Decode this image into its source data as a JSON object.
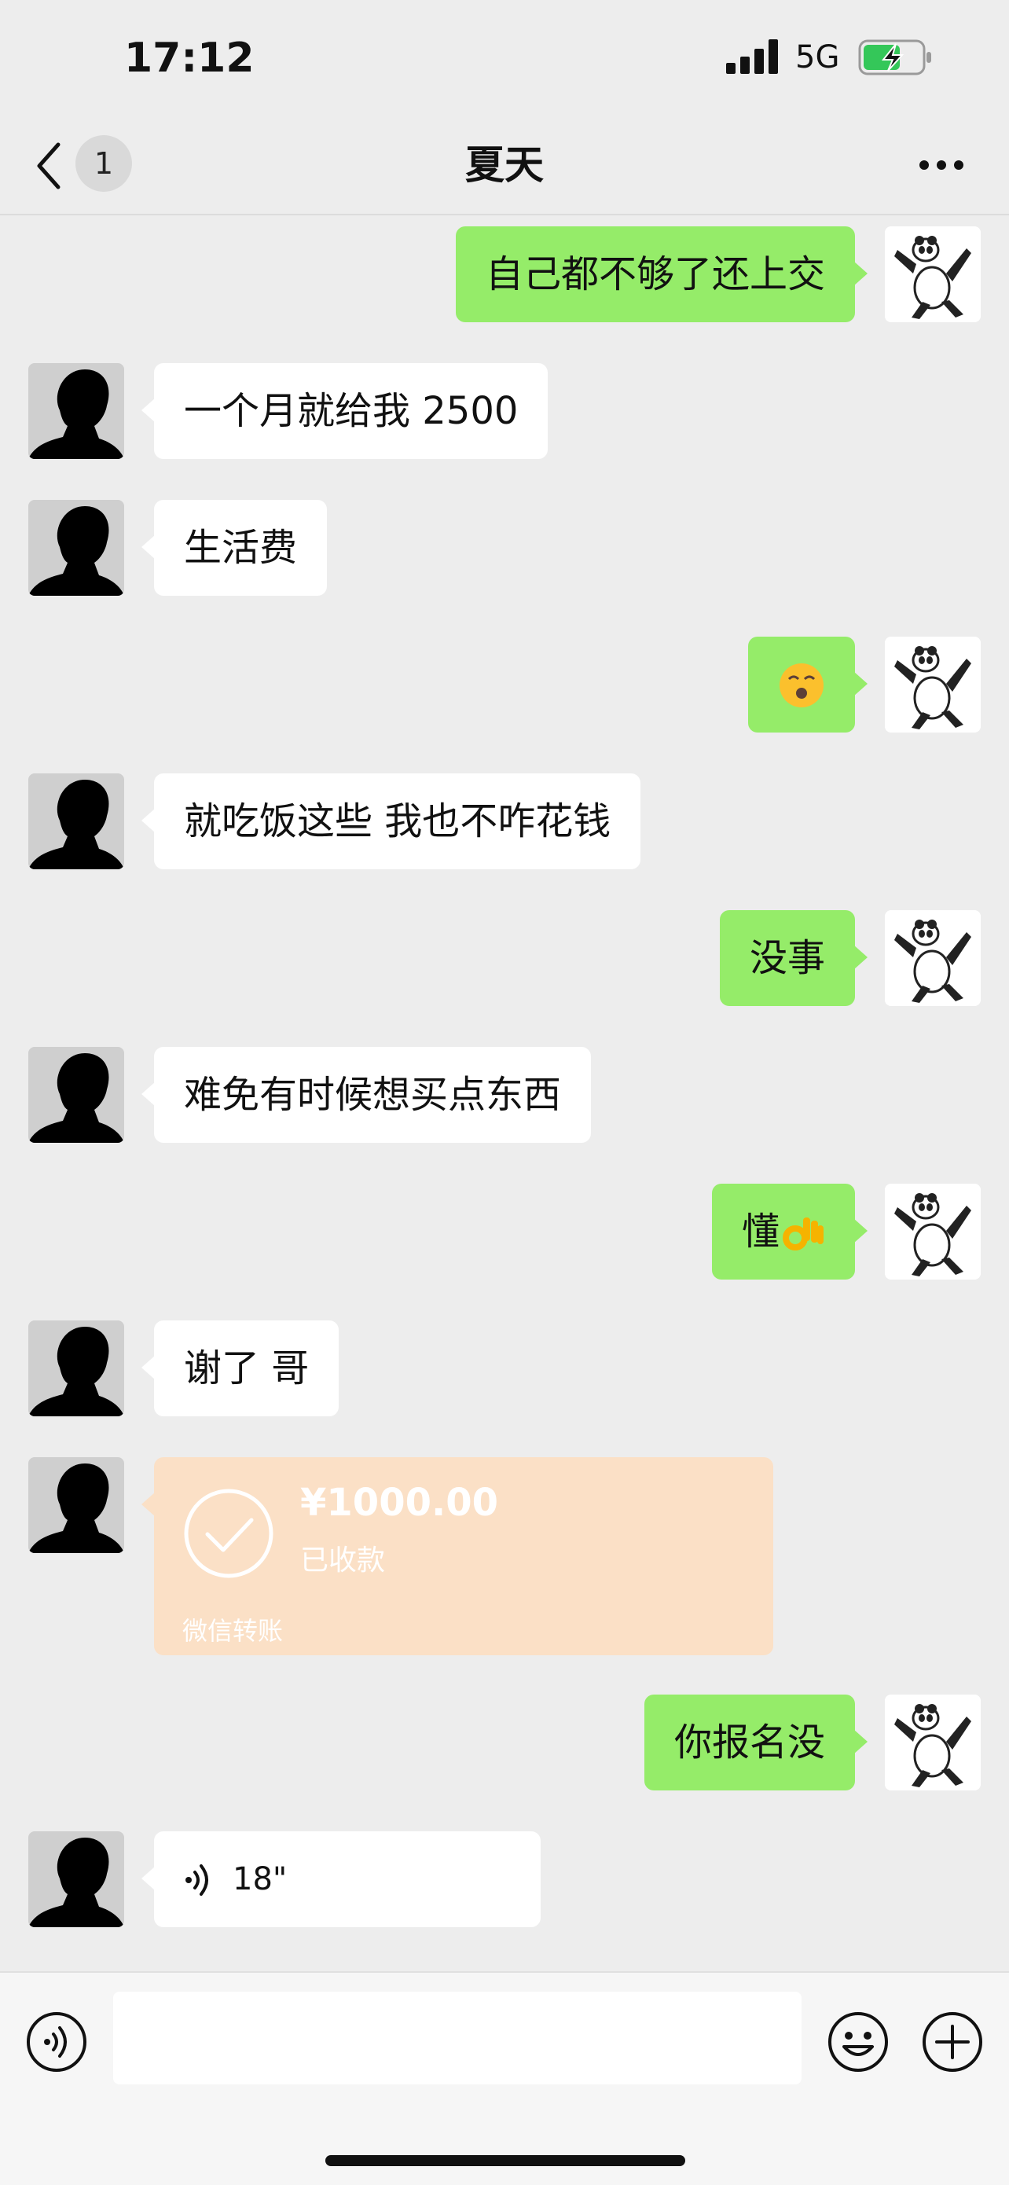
{
  "status_bar": {
    "time": "17:12",
    "network": "5G"
  },
  "nav": {
    "unread_count": "1",
    "title": "夏天"
  },
  "messages": [
    {
      "id": "m1",
      "side": "right",
      "text": "自己都不够了还上交"
    },
    {
      "id": "m2",
      "side": "left",
      "text": "一个月就给我 2500"
    },
    {
      "id": "m3",
      "side": "left",
      "text": "生活费"
    },
    {
      "id": "m4",
      "side": "right",
      "emoji": "kiss-face"
    },
    {
      "id": "m5",
      "side": "left",
      "text": "就吃饭这些 我也不咋花钱"
    },
    {
      "id": "m6",
      "side": "right",
      "text": "没事"
    },
    {
      "id": "m7",
      "side": "left",
      "text": "难免有时候想买点东西"
    },
    {
      "id": "m8",
      "side": "right",
      "text": "懂",
      "emoji": "ok-hand"
    },
    {
      "id": "m9",
      "side": "left",
      "text": "谢了 哥"
    },
    {
      "id": "m10",
      "side": "left",
      "type": "transfer",
      "amount": "¥1000.00",
      "status": "已收款",
      "footer": "微信转账"
    },
    {
      "id": "m11",
      "side": "right",
      "text": "你报名没"
    },
    {
      "id": "m12",
      "side": "left",
      "type": "voice",
      "duration": "18\""
    }
  ],
  "input_bar": {
    "message_value": "",
    "icons": [
      "voice-mode-icon",
      "emoji-icon",
      "add-icon"
    ]
  },
  "colors": {
    "background": "#ededed",
    "sent_bubble": "#95ec69",
    "received_bubble": "#ffffff",
    "transfer_received": "#fbe0c6"
  }
}
